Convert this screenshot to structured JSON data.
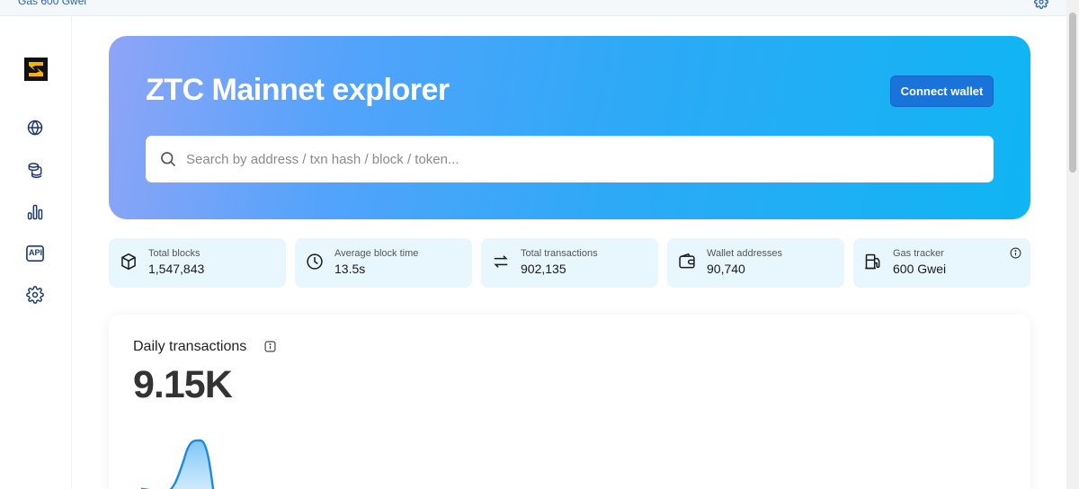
{
  "topbar": {
    "gas_label": "Gas 600 Gwei",
    "settings_icon": "gear-icon"
  },
  "sidebar": {
    "logo": "zigzag-logo",
    "items": [
      {
        "name": "globe-icon"
      },
      {
        "name": "coins-icon"
      },
      {
        "name": "bar-chart-icon"
      },
      {
        "name": "api-icon",
        "text": "API"
      },
      {
        "name": "gear-icon"
      }
    ]
  },
  "hero": {
    "title": "ZTC Mainnet explorer",
    "connect_wallet": "Connect wallet",
    "search_placeholder": "Search by address / txn hash / block / token..."
  },
  "stats": [
    {
      "label": "Total blocks",
      "value": "1,547,843",
      "icon": "cube-icon"
    },
    {
      "label": "Average block time",
      "value": "13.5s",
      "icon": "clock-icon"
    },
    {
      "label": "Total transactions",
      "value": "902,135",
      "icon": "transfer-arrows-icon"
    },
    {
      "label": "Wallet addresses",
      "value": "90,740",
      "icon": "wallet-icon"
    },
    {
      "label": "Gas tracker",
      "value": "600 Gwei",
      "icon": "gas-pump-icon"
    }
  ],
  "daily": {
    "title": "Daily transactions",
    "value": "9.15K"
  },
  "colors": {
    "accent": "#1a73d8",
    "stat_bg": "#e8f6fd",
    "chart_line": "#1e88e5"
  }
}
